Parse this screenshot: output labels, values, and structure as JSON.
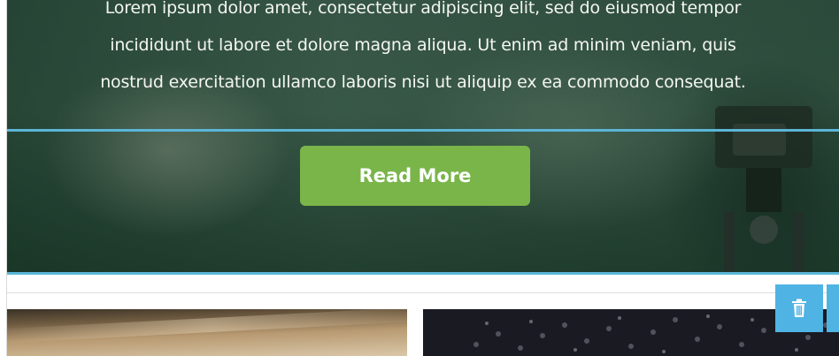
{
  "hero": {
    "lines": [
      "Lorem ipsum dolor amet, consectetur adipiscing elit, sed do eiusmod tempor",
      "incididunt ut labore et dolore magna aliqua. Ut enim ad minim veniam, quis",
      "nostrud exercitation ullamco laboris nisi ut aliquip ex ea commodo consequat."
    ],
    "button_label": "Read More"
  },
  "actions": {
    "delete_icon": "trash-icon"
  },
  "colors": {
    "accent_blue": "#4fb3e4",
    "divider_blue": "#5bb6d8",
    "button_green": "#7ab54a"
  }
}
